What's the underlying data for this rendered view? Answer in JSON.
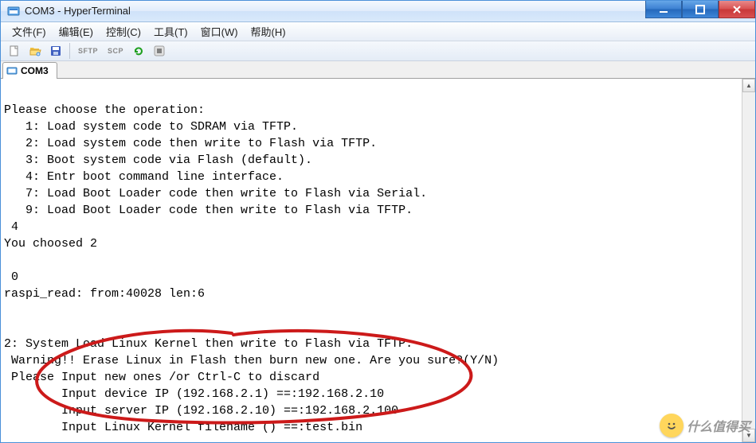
{
  "titlebar": {
    "title": "COM3 - HyperTerminal"
  },
  "menubar": {
    "items": [
      {
        "label": "文件(F)"
      },
      {
        "label": "编辑(E)"
      },
      {
        "label": "控制(C)"
      },
      {
        "label": "工具(T)"
      },
      {
        "label": "窗口(W)"
      },
      {
        "label": "帮助(H)"
      }
    ]
  },
  "toolbar": {
    "new_icon": "new-file-icon",
    "open_icon": "folder-open-icon",
    "save_icon": "save-icon",
    "sftp_label": "SFTP",
    "scp_label": "SCP",
    "refresh_icon": "refresh-icon",
    "stop_icon": "stop-icon"
  },
  "tab": {
    "label": "COM3"
  },
  "terminal": {
    "lines": [
      "",
      "Please choose the operation:",
      "   1: Load system code to SDRAM via TFTP.",
      "   2: Load system code then write to Flash via TFTP.",
      "   3: Boot system code via Flash (default).",
      "   4: Entr boot command line interface.",
      "   7: Load Boot Loader code then write to Flash via Serial.",
      "   9: Load Boot Loader code then write to Flash via TFTP.",
      " 4",
      "You choosed 2",
      "",
      " 0",
      "raspi_read: from:40028 len:6",
      "",
      "",
      "2: System Load Linux Kernel then write to Flash via TFTP.",
      " Warning!! Erase Linux in Flash then burn new one. Are you sure?(Y/N)",
      " Please Input new ones /or Ctrl-C to discard",
      "        Input device IP (192.168.2.1) ==:192.168.2.10",
      "        Input server IP (192.168.2.10) ==:192.168.2.100",
      "        Input Linux Kernel filename () ==:test.bin"
    ]
  },
  "watermark": {
    "text": "什么值得买"
  }
}
